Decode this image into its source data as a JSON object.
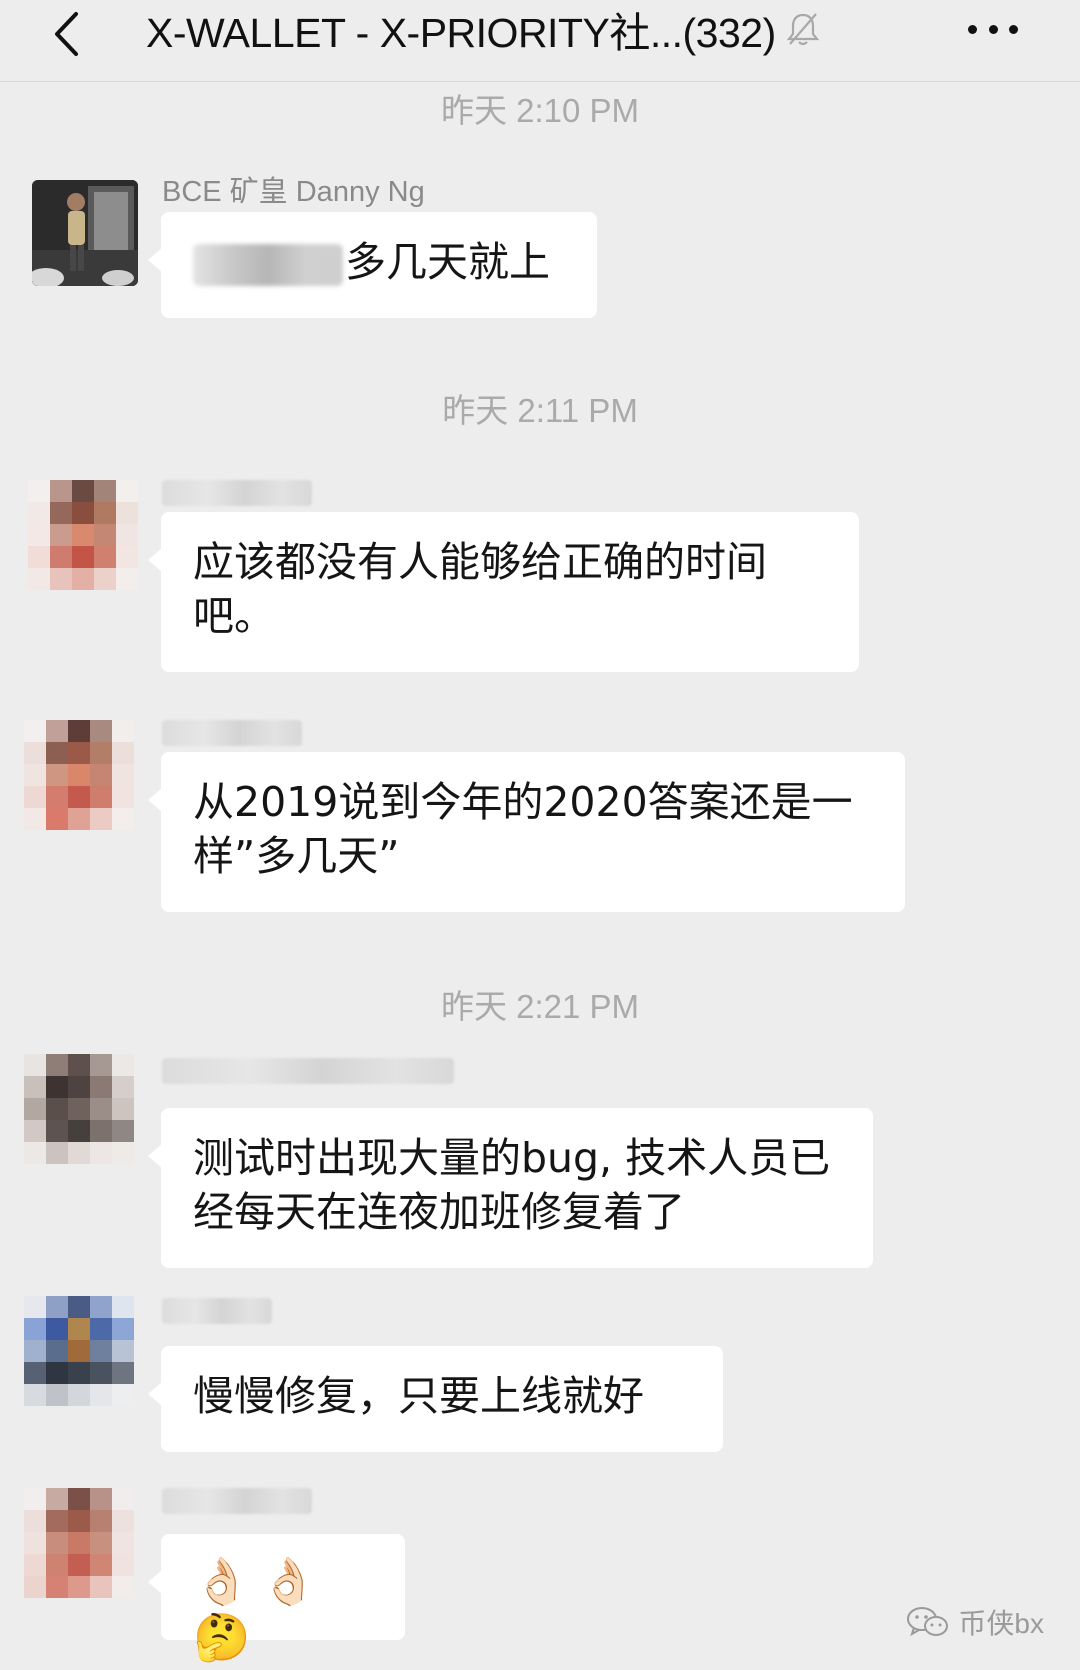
{
  "header": {
    "title": "X-WALLET - X-PRIORITY社...(332)",
    "back_icon": "chevron-left-icon",
    "mute_icon": "bell-off-icon",
    "more_icon": "ellipsis-icon"
  },
  "timestamps": [
    "昨天 2:10 PM",
    "昨天 2:11 PM",
    "昨天 2:21 PM"
  ],
  "messages": [
    {
      "sender": "BCE 矿皇 Danny Ng",
      "text": "多几天就上"
    },
    {
      "sender": "",
      "text": "应该都没有人能够给正确的时间吧。"
    },
    {
      "sender": "",
      "text": "从2019说到今年的2020答案还是一样”多几天”"
    },
    {
      "sender": "",
      "text": "测试时出现大量的bug, 技术人员已经每天在连夜加班修复着了"
    },
    {
      "sender": "",
      "text": "慢慢修复，只要上线就好"
    },
    {
      "sender": "",
      "text": "👌🏻👌🏻🤔"
    }
  ],
  "watermark": {
    "text": "币侠bx",
    "icon": "wechat-icon"
  },
  "colors": {
    "background": "#ededed",
    "bubble": "#ffffff",
    "timestamp": "#aaaaaa"
  }
}
